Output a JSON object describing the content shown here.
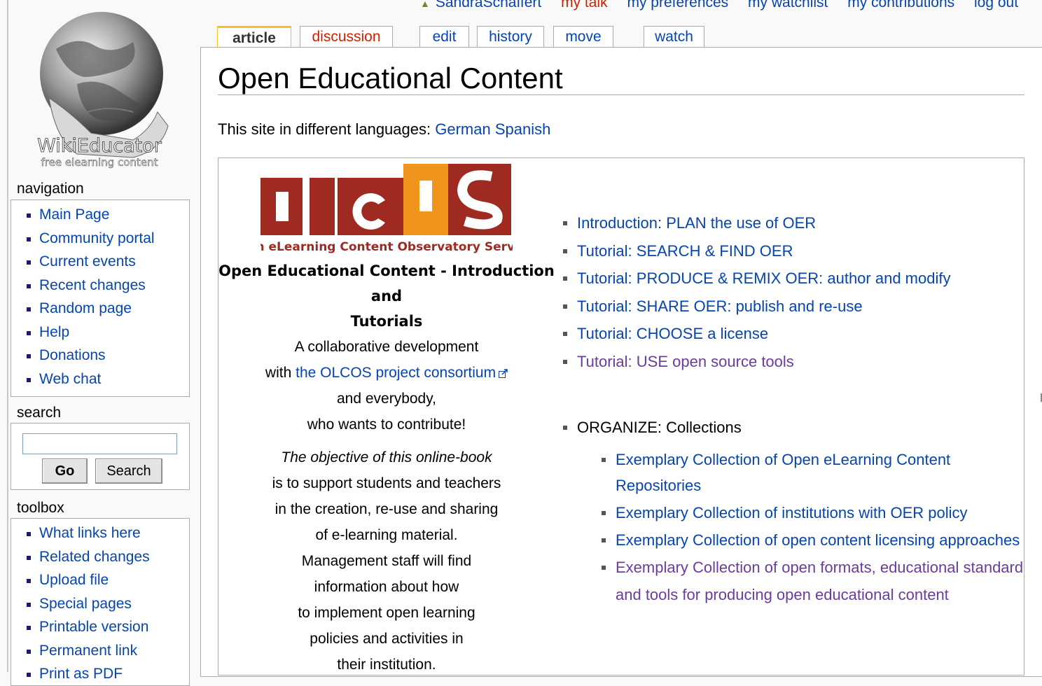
{
  "user_links": {
    "username": "SandraSchaffert",
    "my_talk": "my talk",
    "my_preferences": "my preferences",
    "my_watchlist": "my watchlist",
    "my_contributions": "my contributions",
    "log_out": "log out"
  },
  "logo": {
    "name": "WikiEducator",
    "tagline": "free elearning content"
  },
  "tabs": {
    "article": "article",
    "discussion": "discussion",
    "edit": "edit",
    "history": "history",
    "move": "move",
    "watch": "watch"
  },
  "navigation": {
    "title": "navigation",
    "items": [
      "Main Page",
      "Community portal",
      "Current events",
      "Recent changes",
      "Random page",
      "Help",
      "Donations",
      "Web chat"
    ]
  },
  "search": {
    "title": "search",
    "value": "",
    "go_label": "Go",
    "search_label": "Search"
  },
  "toolbox": {
    "title": "toolbox",
    "items": [
      "What links here",
      "Related changes",
      "Upload file",
      "Special pages",
      "Printable version",
      "Permanent link",
      "Print as PDF"
    ]
  },
  "page": {
    "title": "Open Educational Content",
    "lang_prefix": "This site in different languages:",
    "lang_german": "German",
    "lang_spanish": "Spanish"
  },
  "olcos": {
    "letters": "OLCOS",
    "subtitle": "Open eLearning Content Observatory Services"
  },
  "box": {
    "heading_1": "Open Educational Content - Introduction and",
    "heading_2": "Tutorials",
    "collab_1": "A collaborative development",
    "collab_with": "with",
    "collab_link": "the OLCOS project consortium",
    "collab_3": "and everybody,",
    "collab_4": "who wants to contribute!",
    "objective": "The objective of this online-book",
    "lines": [
      "is to support students and teachers",
      "in the creation, re-use and sharing",
      "of e-learning material.",
      "Management staff will find",
      "information about how",
      "to implement open learning",
      "policies and activities in",
      "their institution."
    ]
  },
  "tutorials": [
    "Introduction: PLAN the use of OER",
    "Tutorial: SEARCH & FIND OER",
    "Tutorial: PRODUCE & REMIX OER: author and modify",
    "Tutorial: SHARE OER: publish and re-use",
    "Tutorial: CHOOSE a license",
    "Tutorial: USE open source tools"
  ],
  "organize": {
    "label": "ORGANIZE: Collections",
    "items": [
      "Exemplary Collection of Open eLearning Content Repositories",
      "Exemplary Collection of institutions with OER policy",
      "Exemplary Collection of open content licensing approaches",
      "Exemplary Collection of open formats, educational standard",
      "and tools for producing open educational content"
    ]
  },
  "colors": {
    "link": "#0645ad",
    "visited_link": "#6b3b9e",
    "new_link": "#cc2200",
    "tab_selected_accent": "#fabd23",
    "olcos_red": "#9e2a22",
    "olcos_orange": "#f0941e"
  }
}
